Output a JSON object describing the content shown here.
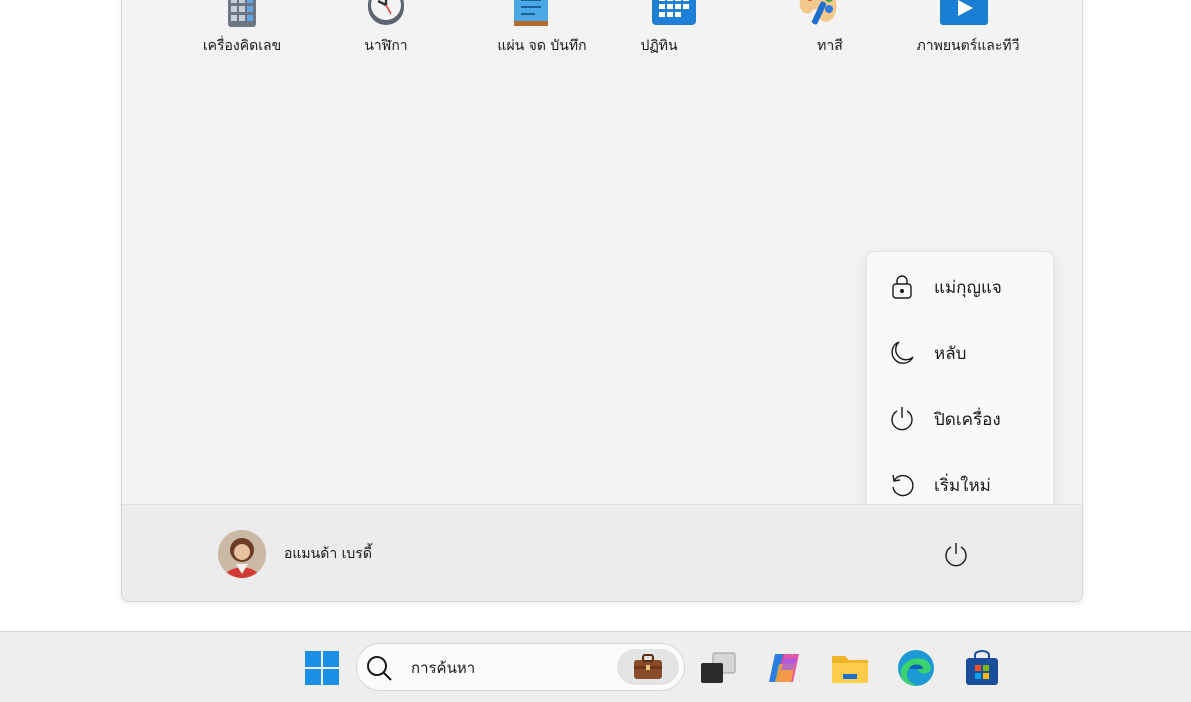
{
  "pinned_apps": [
    {
      "label": "เครื่องคิดเลข",
      "icon": "calculator-icon"
    },
    {
      "label": "นาฬิกา",
      "icon": "clock-icon"
    },
    {
      "label": "แผ่น จด บันทึก",
      "icon": "notepad-icon"
    },
    {
      "label": "ปฏิทิน",
      "icon": "calendar-icon"
    },
    {
      "label": "ทาสี",
      "icon": "paint-icon"
    },
    {
      "label": "ภาพยนตร์และทีวี",
      "icon": "movies-tv-icon"
    }
  ],
  "power_menu": {
    "items": [
      {
        "label": "แม่กุญแจ",
        "icon": "lock-icon"
      },
      {
        "label": "หลับ",
        "icon": "sleep-moon-icon"
      },
      {
        "label": "ปิดเครื่อง",
        "icon": "power-icon"
      },
      {
        "label": "เริ่มใหม่",
        "icon": "restart-icon"
      }
    ]
  },
  "user": {
    "name": "อแมนด้า เบรดี้"
  },
  "taskbar": {
    "search_placeholder": "การค้นหา",
    "items": [
      "windows-start-icon",
      "search-icon",
      "briefcase-icon",
      "task-view-icon",
      "copilot-icon",
      "file-explorer-icon",
      "edge-icon",
      "store-icon"
    ]
  },
  "colors": {
    "accent": "#0078d4",
    "panel": "#f3f3f3",
    "taskbar": "#eeeeee"
  }
}
